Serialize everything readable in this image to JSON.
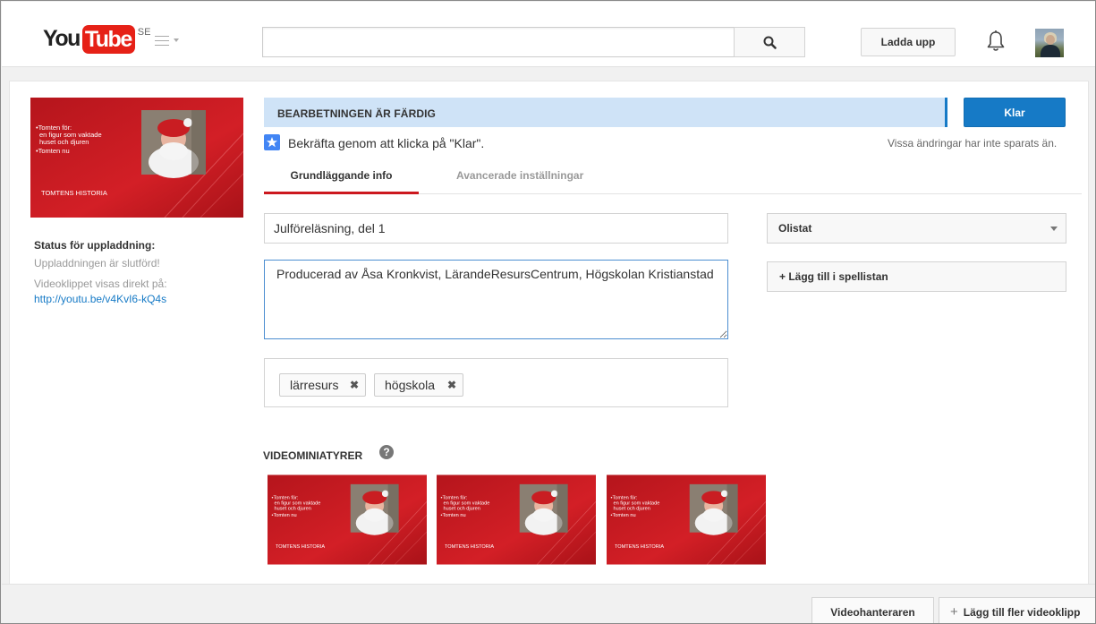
{
  "header": {
    "logo_you": "You",
    "logo_tube": "Tube",
    "logo_country": "SE",
    "search_value": "",
    "upload_label": "Ladda upp"
  },
  "sidebar": {
    "thumb_bullets": [
      "•Tomten för:",
      "en figur som vaktade",
      "huset och djuren",
      "•Tomten nu"
    ],
    "thumb_title": "TOMTENS HISTORIA",
    "status_title": "Status för uppladdning:",
    "status_done": "Uppladdningen är slutförd!",
    "status_direct": "Videoklippet visas direkt på:",
    "video_link": "http://youtu.be/v4KvI6-kQ4s"
  },
  "banner": {
    "text": "BEARBETNINGEN ÄR FÄRDIG",
    "done_label": "Klar",
    "confirm": "Bekräfta genom att klicka på \"Klar\".",
    "unsaved": "Vissa ändringar har inte sparats än."
  },
  "tabs": [
    {
      "label": "Grundläggande info",
      "active": true
    },
    {
      "label": "Avancerade inställningar",
      "active": false
    }
  ],
  "form": {
    "title": "Julföreläsning, del 1",
    "description": "Producerad av Åsa Kronkvist, LärandeResursCentrum, Högskolan Kristianstad",
    "tags": [
      "lärresurs",
      "högskola"
    ],
    "privacy": "Olistat",
    "playlist_label": "+ Lägg till i spellistan"
  },
  "thumbnails": {
    "title": "VIDEOMINIATYRER",
    "help": "?"
  },
  "bottom": {
    "manager_label": "Videohanteraren",
    "more_label": "Lägg till fler videoklipp"
  },
  "colors": {
    "youtube_red": "#e62117",
    "accent_blue": "#167ac6",
    "banner_bg": "#cfe3f7",
    "tab_underline": "#cc181e"
  }
}
